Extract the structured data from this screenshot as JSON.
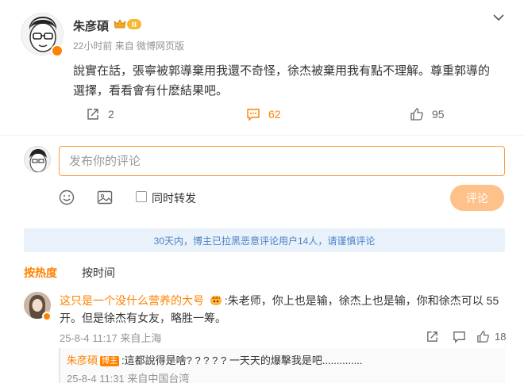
{
  "post": {
    "author": "朱彦碩",
    "time": "22小时前",
    "source": "来自 微博网页版",
    "text": "說實在話，張寧被郭導棄用我還不奇怪，徐杰被棄用我有點不理解。尊重郭導的選擇，看看會有什麽結果吧。",
    "repost_count": "2",
    "comment_count": "62",
    "like_count": "95"
  },
  "composer": {
    "placeholder": "发布你的评论",
    "also_repost_label": "同时转发",
    "send_label": "评论"
  },
  "notice": "30天内，博主已拉黑恶意评论用户14人，请谨慎评论",
  "tabs": {
    "hot": "按热度",
    "time": "按时间"
  },
  "comments": [
    {
      "user": "这只是一个没什么营养的大号",
      "text": ":朱老师，你上也是输，徐杰上也是输，你和徐杰可以 55开。但是徐杰有女友，略胜一筹。",
      "meta": "25-8-4 11:17 来自上海",
      "like_count": "18",
      "reply": {
        "user": "朱彦碩",
        "tag": "博主",
        "text": ":這都說得是啥? ? ? ? ?  一天天的爆擊我是吧..............",
        "meta": "25-8-4 11:31 来自中国台湾"
      }
    }
  ],
  "colors": {
    "accent": "#ff8200",
    "notice_bg": "#e9f1fb",
    "notice_text": "#4a82c4",
    "send_disabled": "#ffc18a"
  }
}
